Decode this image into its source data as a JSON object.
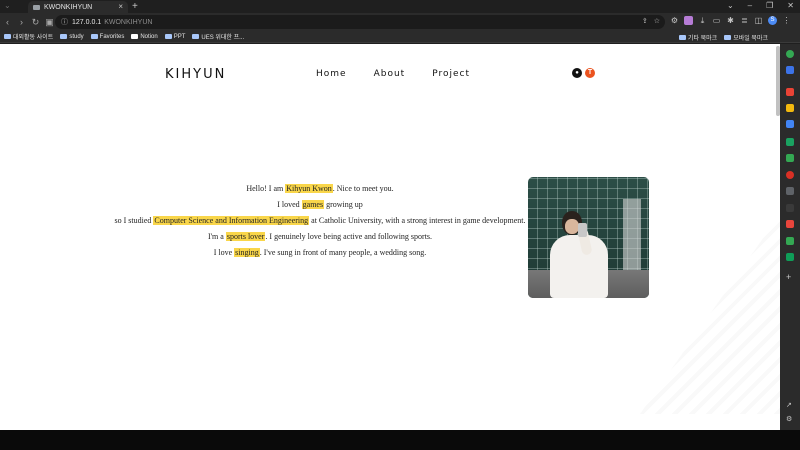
{
  "browser": {
    "tab_title": "KWONKIHYUN",
    "new_tab_symbol": "+",
    "close_symbol": "×",
    "url_host": "127.0.0.1",
    "url_title": "KWONKIHYUN"
  },
  "bookmarks": {
    "items": [
      {
        "label": "대외활동 사이트"
      },
      {
        "label": "study"
      },
      {
        "label": "Favorites"
      },
      {
        "label": "Notion"
      },
      {
        "label": "PPT"
      },
      {
        "label": "UES 위대한 프..."
      }
    ],
    "right_items": [
      {
        "label": "기타 북마크"
      },
      {
        "label": "모바일 북마크"
      }
    ]
  },
  "site": {
    "brand": "KIHYUN",
    "nav": [
      {
        "label": "Home"
      },
      {
        "label": "About"
      },
      {
        "label": "Project"
      }
    ],
    "social": {
      "github_icon": "github-icon",
      "tistory_icon": "tistory-icon",
      "tistory_glyph": "T"
    }
  },
  "intro": {
    "line1": {
      "pre": "Hello! I am ",
      "hl": "Kihyun Kwon",
      "post": ". Nice to meet you."
    },
    "line2": {
      "pre": "I loved ",
      "hl": "games",
      "post": " growing up"
    },
    "line3": {
      "pre": "so I studied ",
      "hl": "Computer Science and Information Engineering",
      "post": " at Catholic University, with a strong interest in game development."
    },
    "line4": {
      "pre": "I'm a ",
      "hl": "sports lover",
      "post": ". I genuinely love being active and following sports."
    },
    "line5": {
      "pre": "I love ",
      "hl": "singing",
      "post": ". I've sung in front of many people, a wedding song."
    }
  },
  "colors": {
    "highlight": "#f9d64a",
    "browser_dark": "#2b2b2b"
  }
}
